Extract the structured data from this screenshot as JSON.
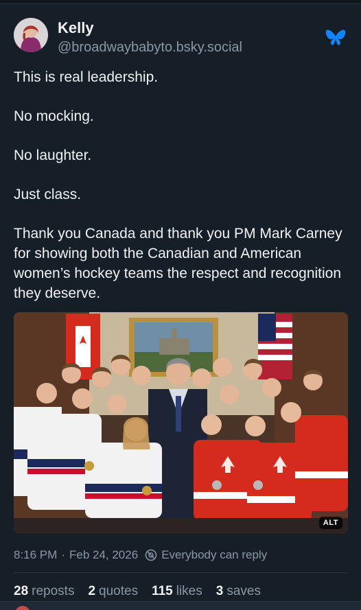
{
  "post": {
    "author_name": "Kelly",
    "author_handle": "@broadwaybabyto.bsky.social",
    "brand_icon": "bluesky-butterfly-icon",
    "text": {
      "line1": "This is real leadership.",
      "line2": "No mocking.",
      "line3": "No laughter.",
      "line4": "Just class.",
      "line5": "Thank you Canada and thank you PM Mark Carney for showing both the Canadian and American women’s hockey teams the respect and recognition they deserve."
    },
    "image": {
      "alt_badge": "ALT"
    },
    "meta": {
      "time": "8:16 PM",
      "separator": "·",
      "date": "Feb 24, 2026",
      "reply_setting": "Everybody can reply"
    },
    "stats": {
      "reposts_count": "28",
      "reposts_label": "reposts",
      "quotes_count": "2",
      "quotes_label": "quotes",
      "likes_count": "115",
      "likes_label": "likes",
      "saves_count": "3",
      "saves_label": "saves"
    }
  },
  "colors": {
    "background": "#161e27",
    "text_primary": "#f1f3f5",
    "text_secondary": "#8b98a5",
    "accent_blue": "#1185fe",
    "canada_red": "#d52b1e",
    "usa_navy": "#1b2a5a"
  }
}
